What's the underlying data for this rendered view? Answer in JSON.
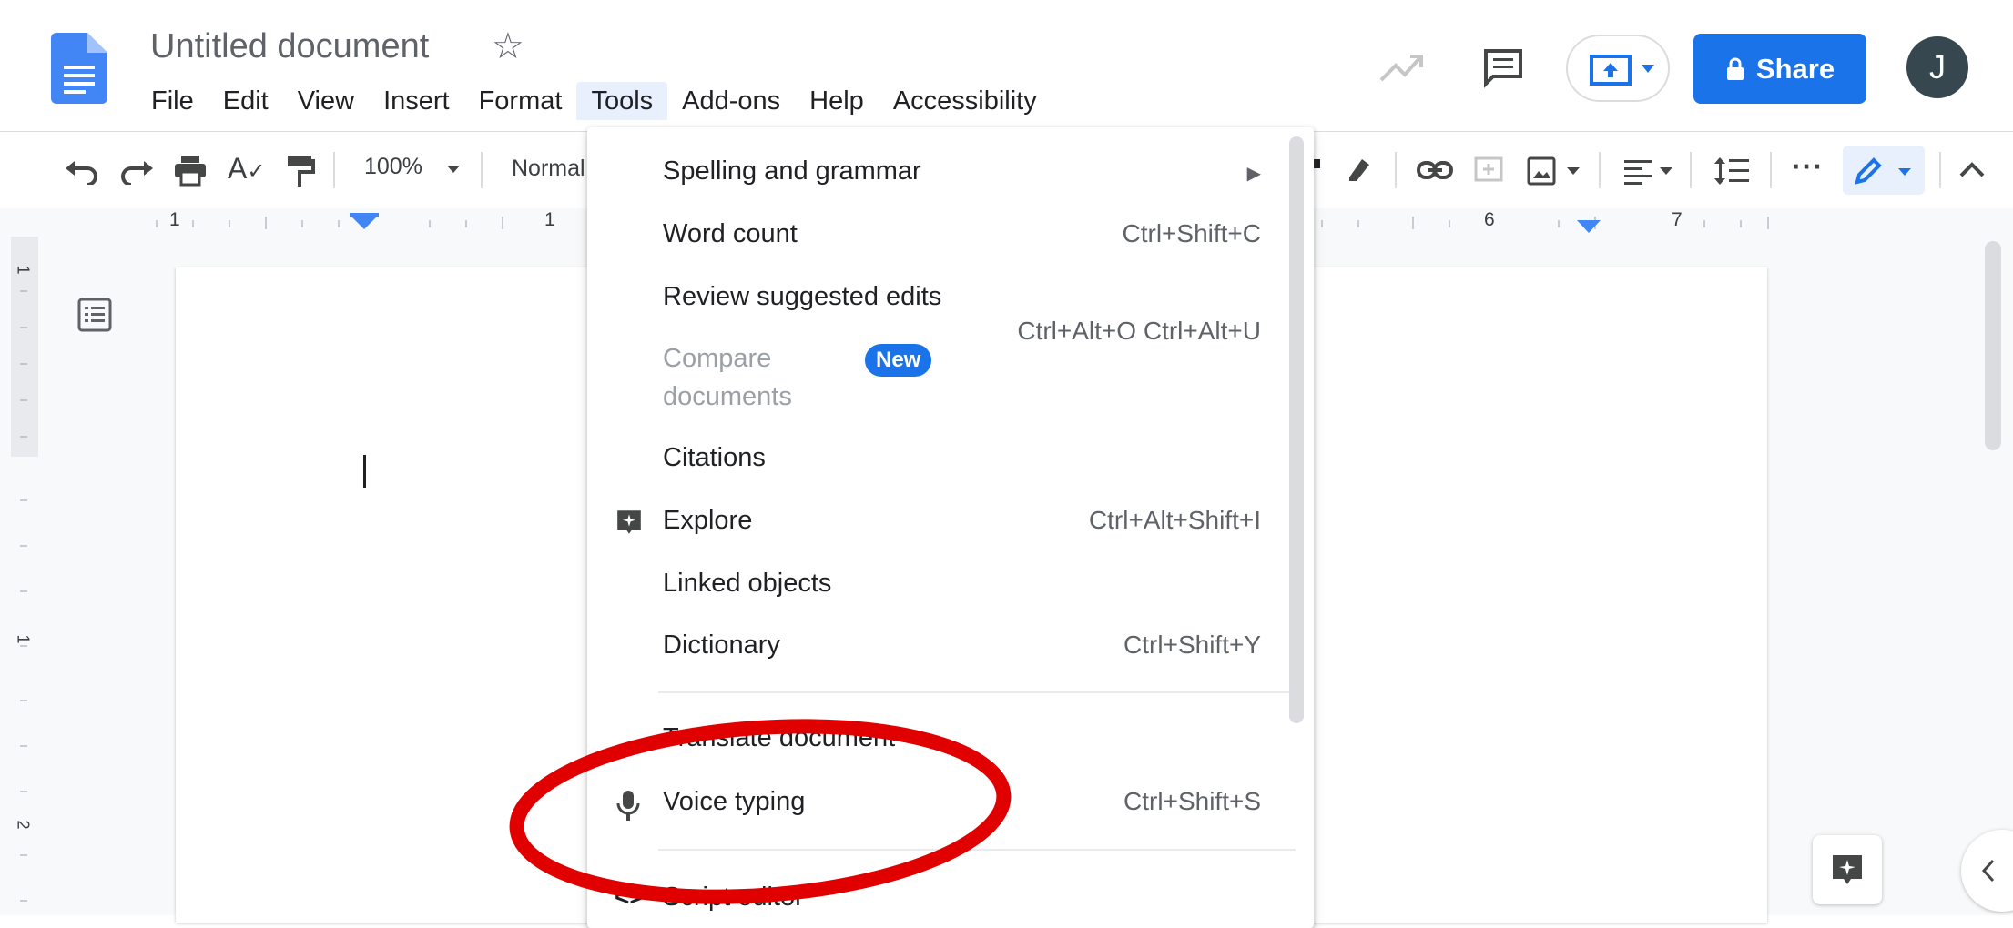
{
  "header": {
    "doc_title": "Untitled document",
    "menus": [
      "File",
      "Edit",
      "View",
      "Insert",
      "Format",
      "Tools",
      "Add-ons",
      "Help",
      "Accessibility"
    ],
    "active_menu": "Tools",
    "share_label": "Share",
    "avatar_initial": "J"
  },
  "toolbar": {
    "zoom": "100%",
    "style": "Normal"
  },
  "ruler": {
    "marks": [
      "1",
      "1",
      "6",
      "7"
    ],
    "vertical_marks": [
      "1",
      "1",
      "2"
    ]
  },
  "tools_menu": {
    "items": [
      {
        "label": "Spelling and grammar",
        "shortcut": "",
        "submenu": true
      },
      {
        "label": "Word count",
        "shortcut": "Ctrl+Shift+C"
      },
      {
        "label": "Review suggested edits",
        "shortcut": "Ctrl+Alt+O Ctrl+Alt+U"
      },
      {
        "label": "Compare documents",
        "shortcut": "",
        "badge": "New",
        "disabled": true
      },
      {
        "label": "Citations",
        "shortcut": ""
      },
      {
        "label": "Explore",
        "shortcut": "Ctrl+Alt+Shift+I",
        "icon": "explore-icon"
      },
      {
        "label": "Linked objects",
        "shortcut": ""
      },
      {
        "label": "Dictionary",
        "shortcut": "Ctrl+Shift+Y"
      },
      {
        "label": "Translate document",
        "shortcut": ""
      },
      {
        "label": "Voice typing",
        "shortcut": "Ctrl+Shift+S",
        "icon": "microphone-icon"
      },
      {
        "label": "Script editor",
        "shortcut": "",
        "icon": "code-icon"
      }
    ],
    "compare_line1": "Compare",
    "compare_line2": "documents"
  },
  "colors": {
    "accent": "#1a73e8",
    "annotation": "#e00000"
  }
}
